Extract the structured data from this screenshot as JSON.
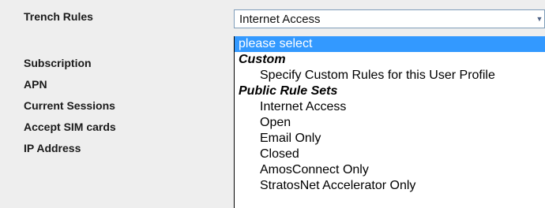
{
  "labels": {
    "trench_rules": "Trench Rules",
    "subscription": "Subscription",
    "apn": "APN",
    "current_sessions": "Current Sessions",
    "accept_sim_cards": "Accept SIM cards",
    "ip_address": "IP Address"
  },
  "trench_rules_select": {
    "selected_value": "Internet Access",
    "arrow_icon": "chevron-down-icon",
    "highlight_color": "#3399ff",
    "options": [
      {
        "label": "please select",
        "kind": "option",
        "highlighted": true
      },
      {
        "label": "Custom",
        "kind": "group"
      },
      {
        "label": "Specify Custom Rules for this User Profile",
        "kind": "option"
      },
      {
        "label": "Public Rule Sets",
        "kind": "group"
      },
      {
        "label": "Internet Access",
        "kind": "option"
      },
      {
        "label": "Open",
        "kind": "option"
      },
      {
        "label": "Email Only",
        "kind": "option"
      },
      {
        "label": "Closed",
        "kind": "option"
      },
      {
        "label": "AmosConnect Only",
        "kind": "option"
      },
      {
        "label": "StratosNet Accelerator Only",
        "kind": "option"
      }
    ]
  }
}
